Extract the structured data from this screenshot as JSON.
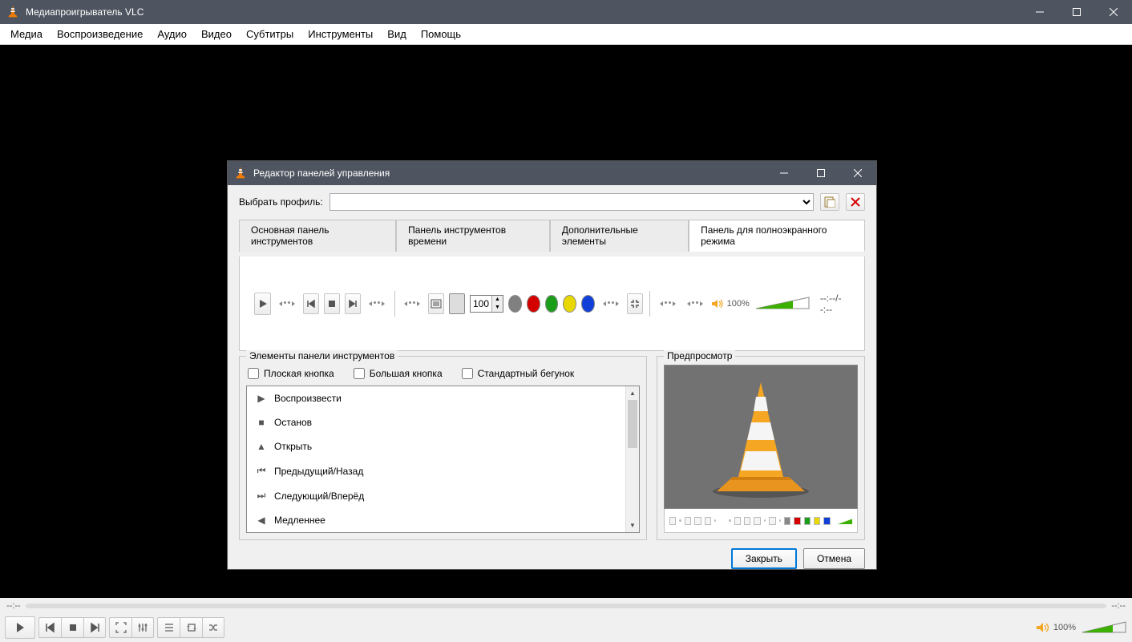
{
  "main": {
    "title": "Медиапроигрыватель VLC",
    "menu": [
      "Медиа",
      "Воспроизведение",
      "Аудио",
      "Видео",
      "Субтитры",
      "Инструменты",
      "Вид",
      "Помощь"
    ],
    "time_left": "--:--",
    "time_right": "--:--",
    "volume_label": "100%"
  },
  "dialog": {
    "title": "Редактор панелей управления",
    "profile_label": "Выбрать профиль:",
    "tabs": [
      "Основная панель инструментов",
      "Панель инструментов времени",
      "Дополнительные элементы",
      "Панель для полноэкранного режима"
    ],
    "active_tab": 3,
    "toolbar": {
      "spin_value": "100",
      "volume_label": "100%",
      "time_display": "--:--/--:--",
      "colors": [
        "#808080",
        "#d40000",
        "#1a9e1a",
        "#e8d800",
        "#1040d8"
      ]
    },
    "elements_legend": "Элементы панели инструментов",
    "preview_legend": "Предпросмотр",
    "checkboxes": {
      "flat": "Плоская кнопка",
      "big": "Большая кнопка",
      "slider": "Стандартный бегунок"
    },
    "elements": [
      {
        "icon": "play",
        "label": "Воспроизвести"
      },
      {
        "icon": "stop",
        "label": "Останов"
      },
      {
        "icon": "eject",
        "label": "Открыть"
      },
      {
        "icon": "prev",
        "label": "Предыдущий/Назад"
      },
      {
        "icon": "next",
        "label": "Следующий/Вперёд"
      },
      {
        "icon": "slow",
        "label": "Медленнее"
      }
    ],
    "buttons": {
      "close": "Закрыть",
      "cancel": "Отмена"
    }
  }
}
